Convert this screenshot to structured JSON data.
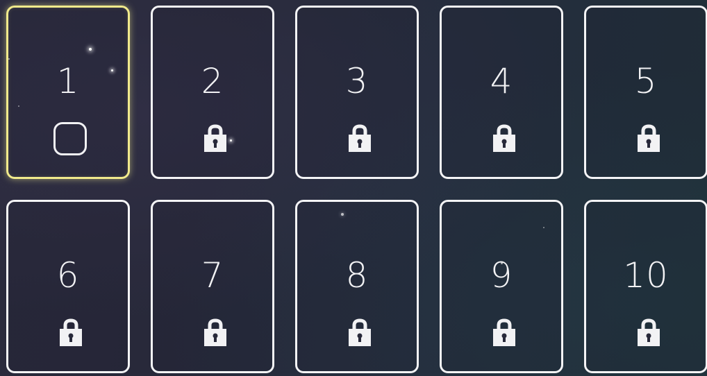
{
  "levels": [
    {
      "number": "1",
      "status": "unlocked",
      "selected": true
    },
    {
      "number": "2",
      "status": "locked",
      "selected": false
    },
    {
      "number": "3",
      "status": "locked",
      "selected": false
    },
    {
      "number": "4",
      "status": "locked",
      "selected": false
    },
    {
      "number": "5",
      "status": "locked",
      "selected": false
    },
    {
      "number": "6",
      "status": "locked",
      "selected": false
    },
    {
      "number": "7",
      "status": "locked",
      "selected": false
    },
    {
      "number": "8",
      "status": "locked",
      "selected": false
    },
    {
      "number": "9",
      "status": "locked",
      "selected": false
    },
    {
      "number": "10",
      "status": "locked",
      "selected": false
    }
  ],
  "colors": {
    "card_border": "#f4f4f6",
    "selected_border": "#f1ea8c",
    "text": "#f2f2f4"
  },
  "icons": {
    "locked": "padlock-icon",
    "unlocked": "rounded-square-icon"
  }
}
